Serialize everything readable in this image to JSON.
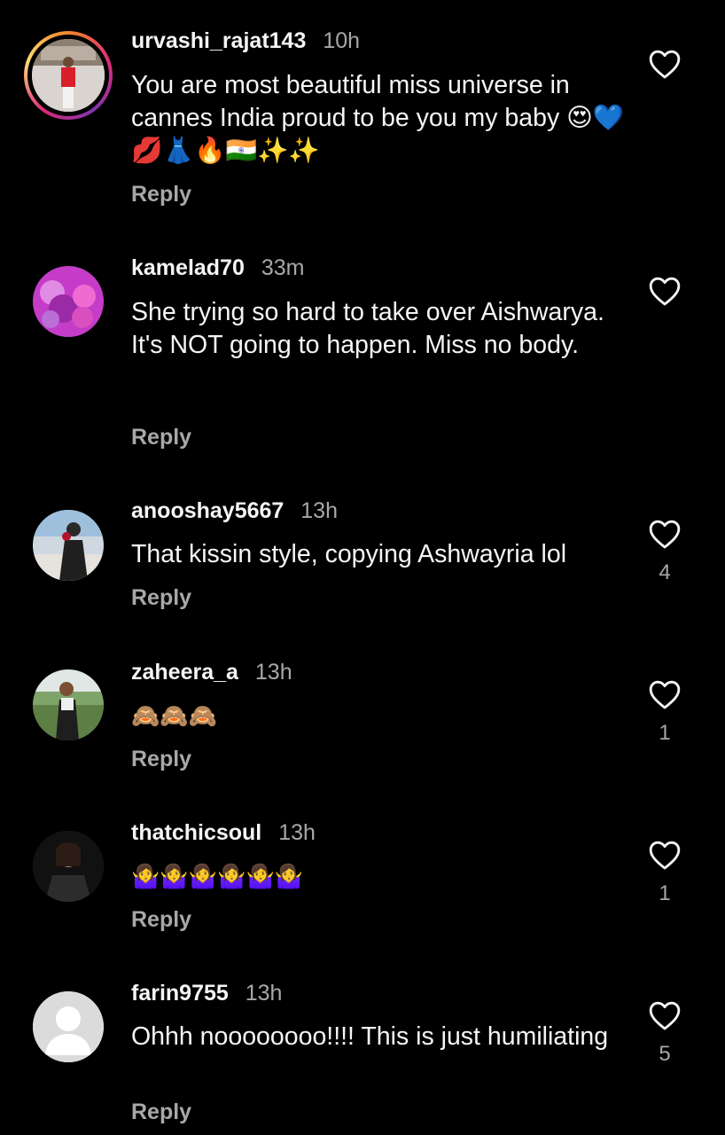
{
  "comments": [
    {
      "username": "urvashi_rajat143",
      "time": "10h",
      "text": "You are most beautiful miss universe in cannes India proud to be you my baby 😍💙💋👗🔥🇮🇳✨✨",
      "reply": "Reply",
      "likes": ""
    },
    {
      "username": "kamelad70",
      "time": "33m",
      "text": "She trying so hard to take over Aishwarya. It's NOT going to happen. Miss no body.",
      "reply": "Reply",
      "likes": ""
    },
    {
      "username": "anooshay5667",
      "time": "13h",
      "text": "That kissin style, copying Ashwayria lol",
      "reply": "Reply",
      "likes": "4"
    },
    {
      "username": "zaheera_a",
      "time": "13h",
      "text": "🙈🙈🙈",
      "reply": "Reply",
      "likes": "1"
    },
    {
      "username": "thatchicsoul",
      "time": "13h",
      "text": "🤷‍♀️🤷‍♀️🤷‍♀️🤷‍♀️🤷‍♀️🤷‍♀️",
      "reply": "Reply",
      "likes": "1"
    },
    {
      "username": "farin9755",
      "time": "13h",
      "text": "Ohhh noooooooo!!!! This is just humiliating",
      "reply": "Reply",
      "likes": "5"
    }
  ],
  "icons": {
    "like": "heart-outline-icon",
    "default_avatar": "person-silhouette-icon"
  },
  "colors": {
    "background": "#000000",
    "primary_text": "#f5f5f5",
    "secondary_text": "#a8a8a8"
  }
}
